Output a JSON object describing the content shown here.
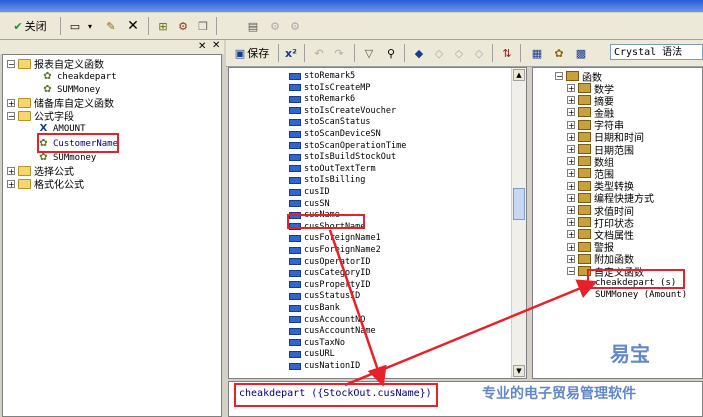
{
  "toolbar": {
    "close_label": "关闭"
  },
  "toolbar2": {
    "save_label": "保存",
    "syntax_select": "Crystal 语法"
  },
  "left_tree": {
    "report_functions": "报表自定义函数",
    "fn1": "cheakdepart",
    "fn2": "SUMMoney",
    "stored_functions": "储备库自定义函数",
    "formula_fields": "公式字段",
    "f1": "AMOUNT",
    "f2": "CustomerName",
    "f3": "SUMmoney",
    "selection_formula": "选择公式",
    "format_formula": "格式化公式"
  },
  "fields": [
    "stoRemark5",
    "stoIsCreateMP",
    "stoRemark6",
    "stoIsCreateVoucher",
    "stoScanStatus",
    "stoScanDeviceSN",
    "stoScanOperationTime",
    "stoIsBuildStockOut",
    "stoOutTextTerm",
    "stoIsBilling",
    "cusID",
    "cusSN",
    "cusName",
    "cusShortName",
    "cusForeignName1",
    "cusForeignName2",
    "cusOperatorID",
    "cusCategoryID",
    "cusPropertyID",
    "cusStatusID",
    "cusBank",
    "cusAccountNO",
    "cusAccountName",
    "cusTaxNo",
    "cusURL",
    "cusNationID"
  ],
  "right_tree": {
    "root": "函数",
    "items": [
      "数学",
      "摘要",
      "金融",
      "字符串",
      "日期和时间",
      "日期范围",
      "数组",
      "范围",
      "类型转换",
      "编程快捷方式",
      "求值时间",
      "打印状态",
      "文档属性",
      "警报",
      "附加函数",
      "自定义函数"
    ],
    "custom_fn1": "cheakdepart (s)",
    "custom_fn2": "SUMMoney (Amount)"
  },
  "formula": {
    "text": "cheakdepart ({StockOut.cusName})"
  },
  "watermark": {
    "brand": "易宝",
    "slogan": "专业的电子贸易管理软件"
  },
  "colors": {
    "highlight": "#e8202a",
    "accent": "#3a6ab8"
  }
}
